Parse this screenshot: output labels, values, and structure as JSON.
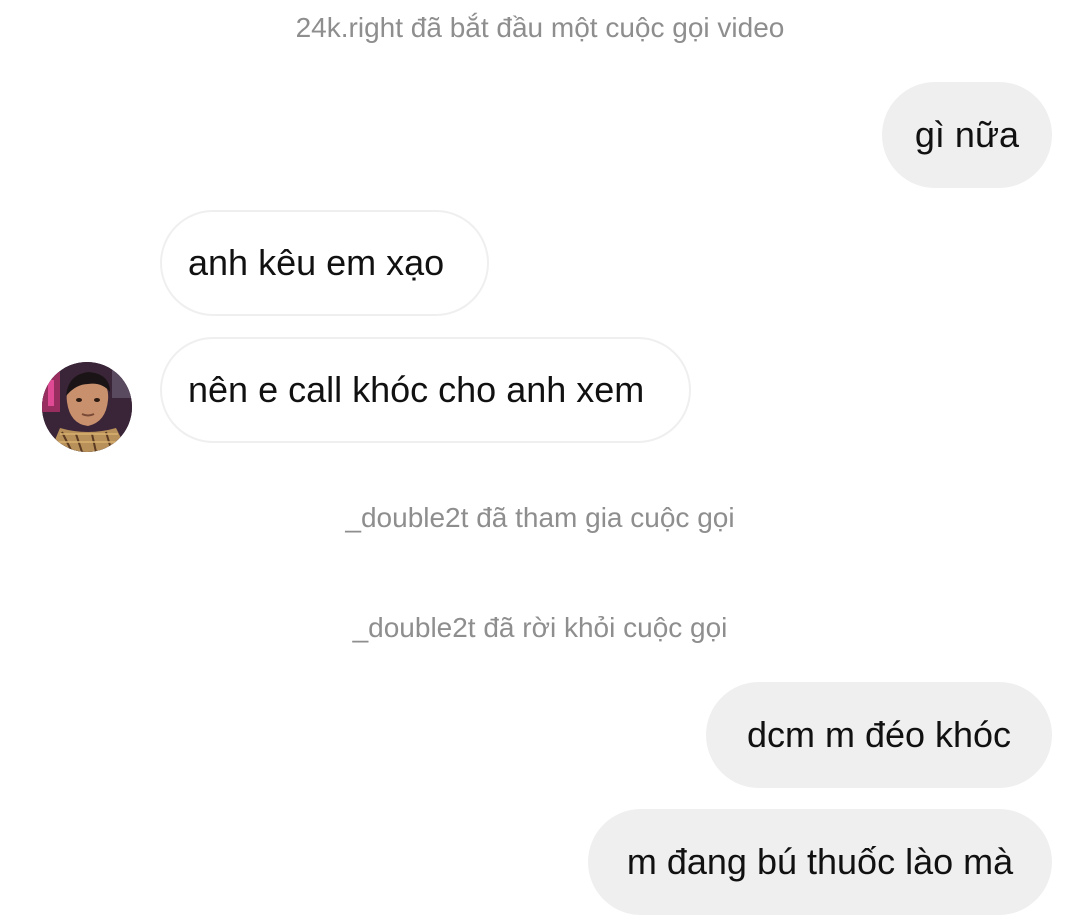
{
  "conversation": {
    "system_messages": [
      "24k.right đã bắt đầu một cuộc gọi video",
      "_double2t đã tham gia cuộc gọi",
      "_double2t đã rời khỏi cuộc gọi"
    ],
    "outgoing_messages": [
      "gì nữa",
      "dcm m đéo khóc",
      "m đang bú thuốc lào mà"
    ],
    "incoming_messages": [
      "anh kêu em xạo",
      "nên e call khóc cho anh xem"
    ],
    "colors": {
      "outgoing_bubble": "#efefef",
      "incoming_border": "#efefef",
      "system_text": "#8e8e8e",
      "message_text": "#111111"
    }
  }
}
